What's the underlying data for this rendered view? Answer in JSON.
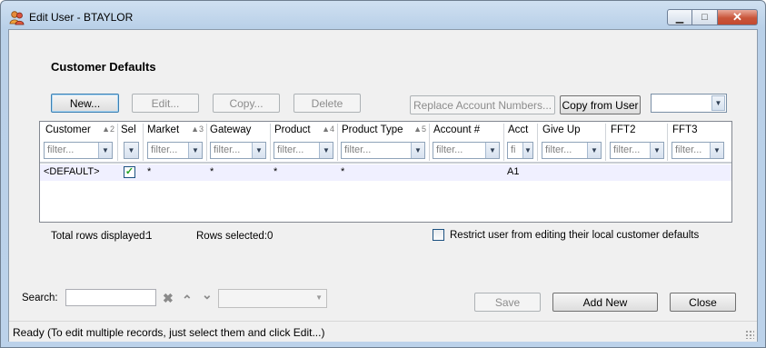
{
  "window": {
    "title": "Edit User - BTAYLOR",
    "minimize_label": "▁",
    "maximize_label": "□",
    "close_label": "✕"
  },
  "section_title": "Customer Defaults",
  "toolbar": {
    "new_label": "New...",
    "edit_label": "Edit...",
    "copy_label": "Copy...",
    "delete_label": "Delete",
    "replace_label": "Replace Account Numbers...",
    "copy_from_user_label": "Copy from User",
    "user_combo_value": ""
  },
  "grid": {
    "columns": [
      {
        "label": "Customer",
        "sort": "▲2"
      },
      {
        "label": "Sel",
        "sort": ""
      },
      {
        "label": "Market",
        "sort": "▲3"
      },
      {
        "label": "Gateway",
        "sort": ""
      },
      {
        "label": "Product",
        "sort": "▲4"
      },
      {
        "label": "Product Type",
        "sort": "▲5"
      },
      {
        "label": "Account #",
        "sort": ""
      },
      {
        "label": "Acct",
        "sort": ""
      },
      {
        "label": "Give Up",
        "sort": ""
      },
      {
        "label": "FFT2",
        "sort": ""
      },
      {
        "label": "FFT3",
        "sort": ""
      }
    ],
    "filter_placeholder": "filter...",
    "filter_short": "fi",
    "rows": [
      {
        "customer": "<DEFAULT>",
        "sel": true,
        "market": "*",
        "gateway": "*",
        "product": "*",
        "product_type": "*",
        "account": "",
        "acct": "A1",
        "give_up": "",
        "fft2": "",
        "fft3": ""
      }
    ]
  },
  "summary": {
    "total_label": "Total rows displayed:",
    "total_value": "1",
    "selected_label": "Rows selected:",
    "selected_value": "0",
    "restrict_label": "Restrict user from editing their local customer defaults",
    "restrict_checked": false
  },
  "search": {
    "label": "Search:",
    "value": "",
    "clear_icon": "✖",
    "up_icon": "⌃",
    "down_icon": "⌄",
    "combo_value": ""
  },
  "footer": {
    "save_label": "Save",
    "add_new_label": "Add New",
    "close_label": "Close"
  },
  "status_text": "Ready (To edit multiple records, just select them and click Edit...)",
  "colors": {
    "title_gradient": "#b9d0e8",
    "client_bg": "#f0f0f0",
    "row_bg": "#f0f0ff",
    "checkmark": "#21a121",
    "close_button": "#c9553a"
  }
}
